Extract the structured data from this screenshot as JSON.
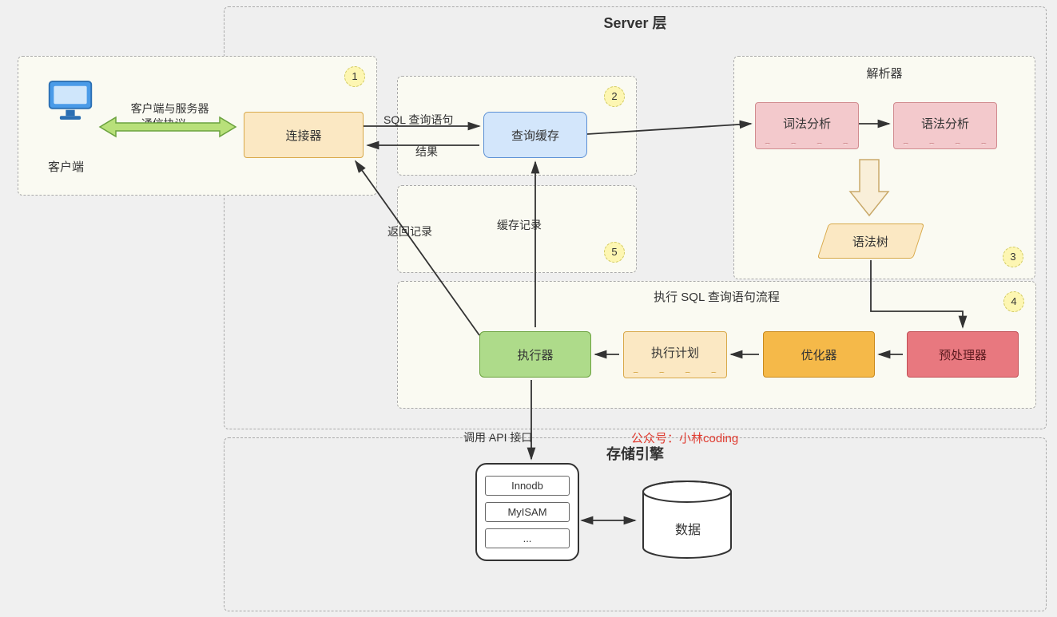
{
  "server_layer": {
    "title": "Server 层"
  },
  "storage_layer": {
    "title": "存储引擎"
  },
  "client": {
    "label": "客户端",
    "arrow_label": "客户端与服务器\n通信协议"
  },
  "nodes": {
    "connector": "连接器",
    "query_cache": "查询缓存",
    "parser_group": "解析器",
    "lexical": "词法分析",
    "syntax": "语法分析",
    "syntax_tree": "语法树",
    "exec_flow_title": "执行 SQL 查询语句流程",
    "executor": "执行器",
    "exec_plan": "执行计划",
    "optimizer": "优化器",
    "preprocessor": "预处理器"
  },
  "edges": {
    "sql_query": "SQL 查询语句",
    "result": "结果",
    "cache_record": "缓存记录",
    "return_record": "返回记录",
    "api_call": "调用 API 接口"
  },
  "steps": {
    "s1": "1",
    "s2": "2",
    "s3": "3",
    "s4": "4",
    "s5": "5"
  },
  "storage": {
    "items": [
      "Innodb",
      "MyISAM",
      "..."
    ],
    "db": "数据"
  },
  "credit": "公众号：小林coding"
}
